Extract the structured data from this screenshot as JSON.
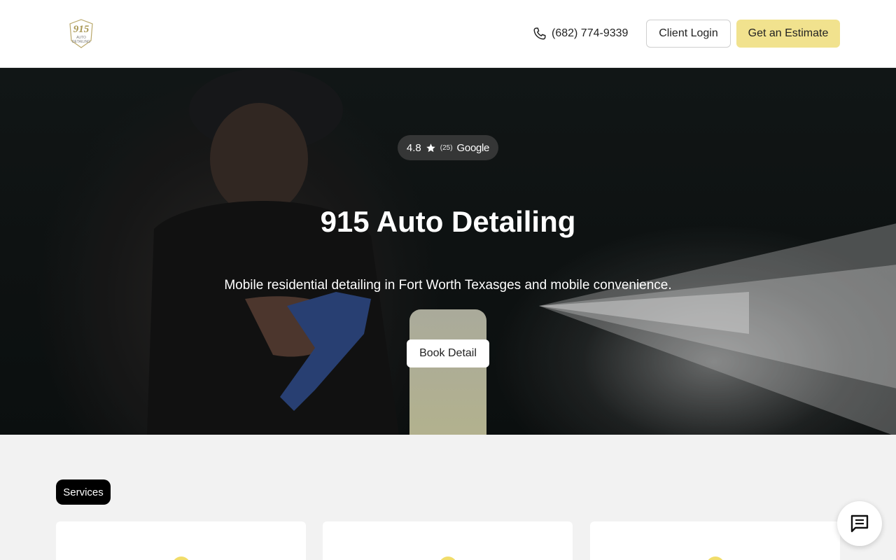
{
  "header": {
    "logo_icon": "915-auto-detailing-logo",
    "phone": "(682) 774-9339",
    "phone_icon": "phone-icon",
    "client_login_label": "Client Login",
    "estimate_label": "Get an Estimate",
    "accent_color": "#f1e28e"
  },
  "hero": {
    "rating": {
      "value": "4.8",
      "star_icon": "star-icon",
      "count": "(25)",
      "source": "Google"
    },
    "title": "915 Auto Detailing",
    "subtitle": "Mobile residential detailing in Fort Worth Texasges and mobile convenience.",
    "cta_label": "Book Detail"
  },
  "services": {
    "badge_label": "Services",
    "cards": [
      {
        "icon": "service-icon"
      },
      {
        "icon": "service-icon"
      },
      {
        "icon": "service-icon"
      }
    ]
  },
  "chat": {
    "icon": "chat-icon"
  }
}
